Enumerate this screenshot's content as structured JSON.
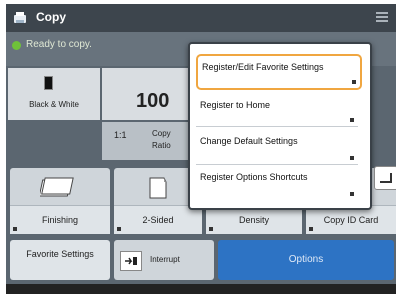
{
  "app": {
    "title": "Copy",
    "status": "Ready to copy."
  },
  "copy_settings": {
    "color_mode": "Black & White",
    "quantity": "100",
    "ratio_value": "1:1",
    "ratio_label": "Copy Ratio"
  },
  "functions": [
    {
      "label": "Finishing"
    },
    {
      "label": "2-Sided"
    },
    {
      "label": "Density"
    },
    {
      "label": "Copy ID Card"
    }
  ],
  "bottom_buttons": {
    "favorite": "Favorite Settings",
    "interrupt": "Interrupt",
    "options": "Options"
  },
  "popup_menu": {
    "items": [
      {
        "label": "Register/Edit Favorite Settings",
        "selected": true
      },
      {
        "label": "Register to Home",
        "selected": false
      },
      {
        "label": "Change Default Settings",
        "selected": false
      },
      {
        "label": "Register Options Shortcuts",
        "selected": false
      }
    ]
  },
  "colors": {
    "accent": "#2d73c4",
    "highlight": "#f0a640",
    "ready": "#6fc23a"
  }
}
